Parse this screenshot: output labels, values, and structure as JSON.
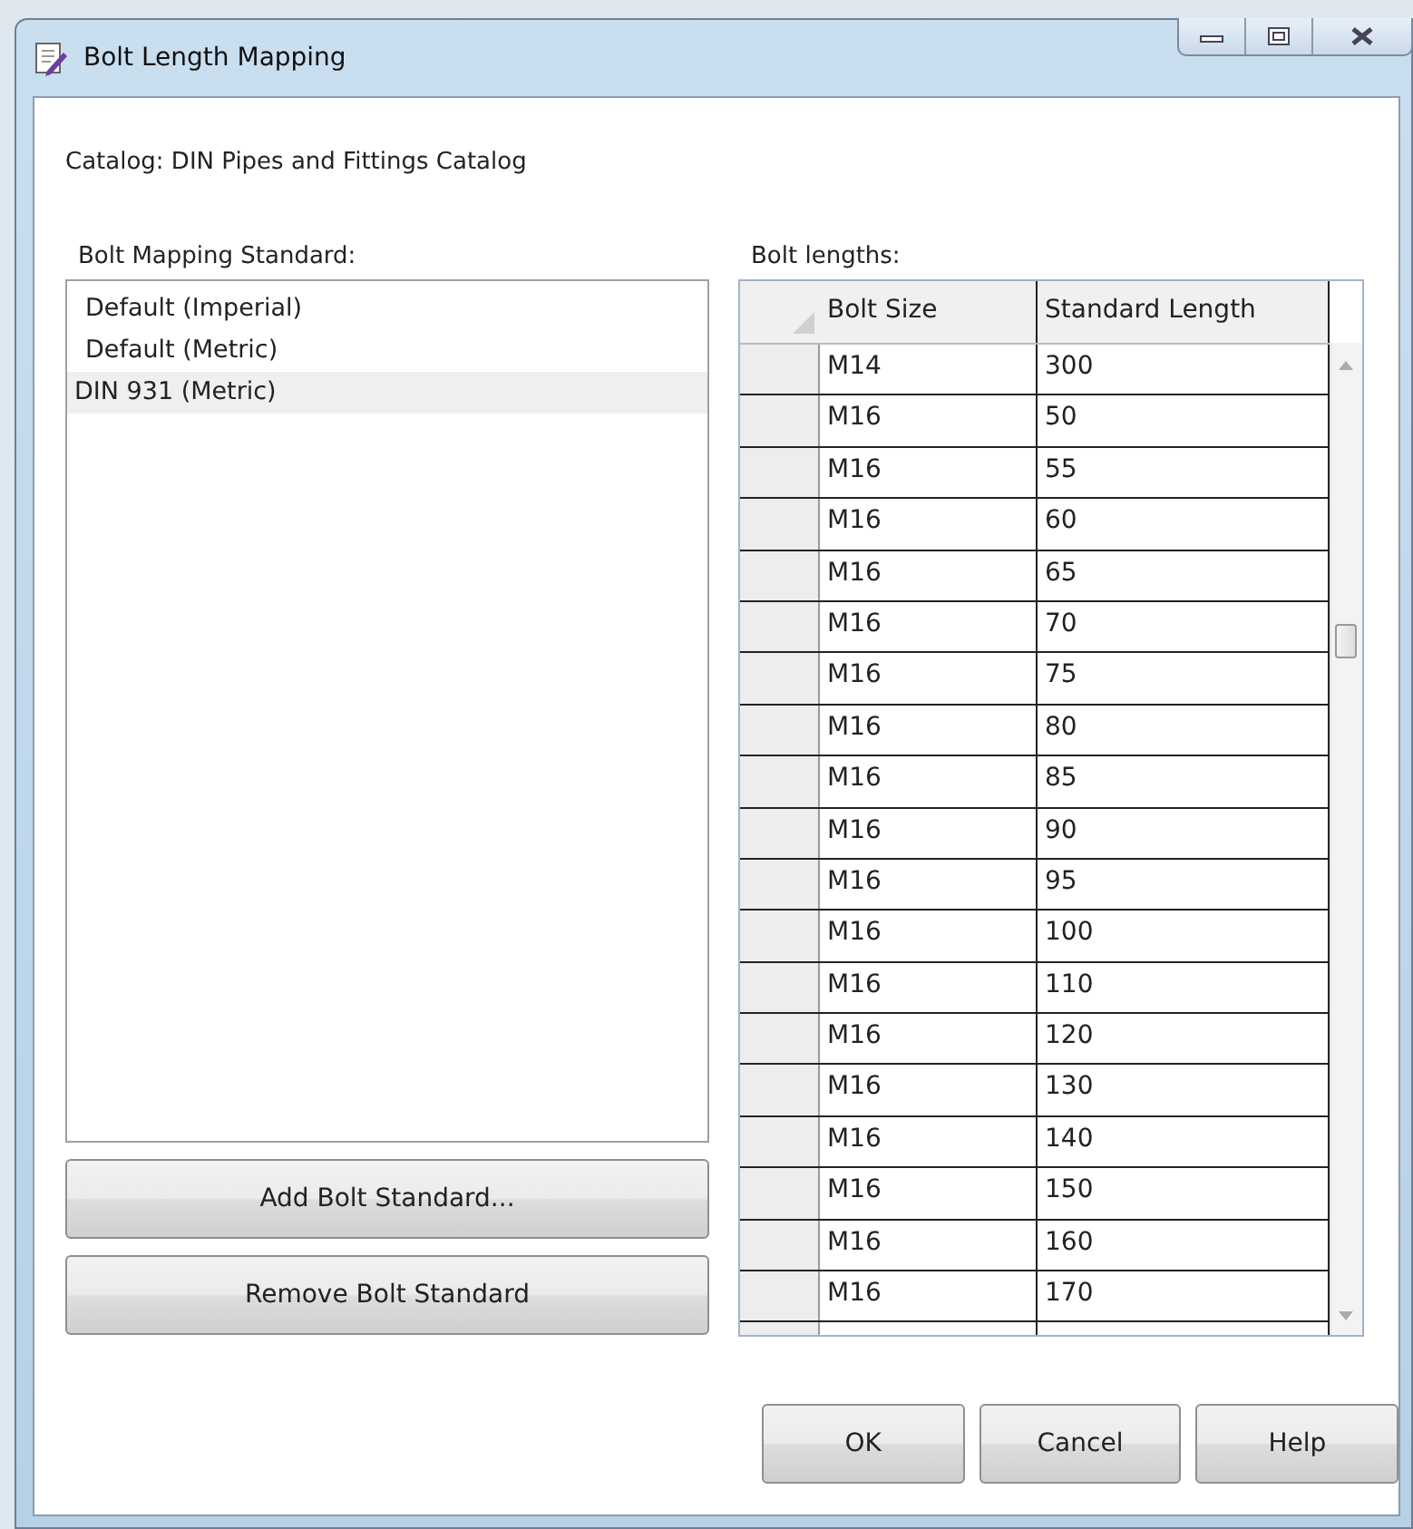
{
  "window": {
    "title": "Bolt Length Mapping"
  },
  "catalog_label": "Catalog: DIN Pipes and Fittings Catalog",
  "standards": {
    "label": "Bolt Mapping Standard:",
    "items": [
      {
        "label": "Default (Imperial)",
        "selected": false
      },
      {
        "label": "Default (Metric)",
        "selected": false
      },
      {
        "label": "DIN 931 (Metric)",
        "selected": true
      }
    ]
  },
  "standard_buttons": [
    "Add Bolt Standard...",
    "Remove Bolt Standard"
  ],
  "bolt_lengths": {
    "label": "Bolt lengths:",
    "columns": [
      "Bolt Size",
      "Standard Length"
    ],
    "rows": [
      [
        "M14",
        "300"
      ],
      [
        "M16",
        "50"
      ],
      [
        "M16",
        "55"
      ],
      [
        "M16",
        "60"
      ],
      [
        "M16",
        "65"
      ],
      [
        "M16",
        "70"
      ],
      [
        "M16",
        "75"
      ],
      [
        "M16",
        "80"
      ],
      [
        "M16",
        "85"
      ],
      [
        "M16",
        "90"
      ],
      [
        "M16",
        "95"
      ],
      [
        "M16",
        "100"
      ],
      [
        "M16",
        "110"
      ],
      [
        "M16",
        "120"
      ],
      [
        "M16",
        "130"
      ],
      [
        "M16",
        "140"
      ],
      [
        "M16",
        "150"
      ],
      [
        "M16",
        "160"
      ],
      [
        "M16",
        "170"
      ]
    ]
  },
  "buttons": [
    "OK",
    "Cancel",
    "Help"
  ]
}
